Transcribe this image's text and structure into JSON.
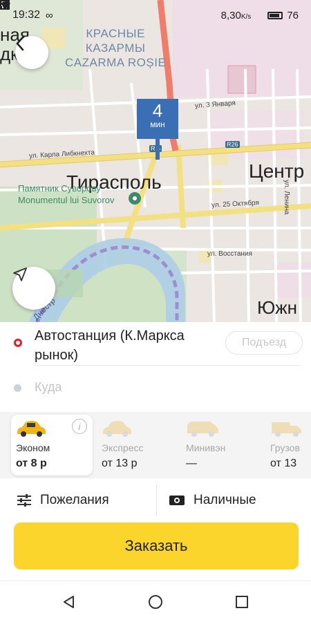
{
  "status_bar": {
    "time": "19:32",
    "loop_icon": "∞",
    "network_speed": "8,30",
    "network_unit": "K/s",
    "battery": "76"
  },
  "map": {
    "district_label": "КРАСНЫЕ\nКАЗАРМЫ\nCAZARMA ROȘIE",
    "partial_top_left": "ная\nдка",
    "city_label": "Тирасполь",
    "center_label": "Центр",
    "south_label": "Южн",
    "monument_label": "Памятник Суворову\nMonumentul lui Suvorov",
    "street_karla": "ул. Карла Либкнехта",
    "street_25oct": "ул. 25 Октября",
    "street_lenina": "ул. Ленина",
    "street_vosstaniya": "ул. Восстания",
    "street_yanvarya": "ул. 3 Января",
    "road_r6": "R 6",
    "road_r26": "R26",
    "river_label": "Днестр",
    "eta_value": "4",
    "eta_unit": "мин"
  },
  "route": {
    "from": "Автостанция (К.Маркса рынок)",
    "entrance_label": "Подъезд",
    "to_placeholder": "Куда"
  },
  "tariffs": [
    {
      "name": "Эконом",
      "price": "от 8 р",
      "selected": true
    },
    {
      "name": "Экспресс",
      "price": "от 13 р",
      "selected": false
    },
    {
      "name": "Минивэн",
      "price": "—",
      "selected": false
    },
    {
      "name": "Грузов",
      "price": "от 13",
      "selected": false
    }
  ],
  "tariff_info_icon": "i",
  "options": {
    "wishes_label": "Пожелания",
    "payment_label": "Наличные"
  },
  "order_button": "Заказать",
  "colors": {
    "accent_yellow": "#fcd52c",
    "eta_blue": "#3a6fb5",
    "from_dot_red": "#e0202b"
  }
}
